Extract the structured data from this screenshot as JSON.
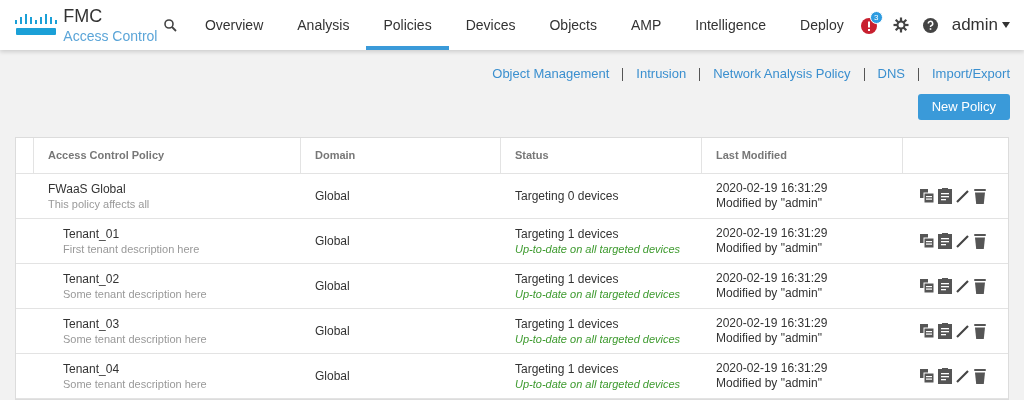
{
  "header": {
    "product": "FMC",
    "subtitle": "Access Control",
    "nav": [
      {
        "label": "Overview",
        "selected": false
      },
      {
        "label": "Analysis",
        "selected": false
      },
      {
        "label": "Policies",
        "selected": true
      },
      {
        "label": "Devices",
        "selected": false
      },
      {
        "label": "Objects",
        "selected": false
      },
      {
        "label": "AMP",
        "selected": false
      },
      {
        "label": "Intelligence",
        "selected": false
      },
      {
        "label": "Deploy",
        "selected": false
      }
    ],
    "alert_count": "3",
    "user": "admin"
  },
  "sub_links": [
    "Object Management",
    "Intrusion",
    "Network Analysis Policy",
    "DNS",
    "Import/Export"
  ],
  "new_policy_button": "New Policy",
  "table": {
    "columns": [
      "Access Control Policy",
      "Domain",
      "Status",
      "Last Modified"
    ],
    "rows": [
      {
        "name": "FWaaS Global",
        "description": "This policy affects all",
        "domain": "Global",
        "status": "Targeting 0 devices",
        "modified": "2020-02-19 16:31:29",
        "modified_by": "Modified by \"admin\"",
        "children": [
          {
            "name": "Tenant_01",
            "description": "First tenant description here",
            "domain": "Global",
            "status": "Targeting 1 devices",
            "status_detail": "Up-to-date on all targeted devices",
            "modified": "2020-02-19 16:31:29",
            "modified_by": "Modified by \"admin\""
          },
          {
            "name": "Tenant_02",
            "description": "Some tenant description here",
            "domain": "Global",
            "status": "Targeting 1 devices",
            "status_detail": "Up-to-date on all targeted devices",
            "modified": "2020-02-19 16:31:29",
            "modified_by": "Modified by \"admin\""
          },
          {
            "name": "Tenant_03",
            "description": "Some tenant description here",
            "domain": "Global",
            "status": "Targeting 1 devices",
            "status_detail": "Up-to-date on all targeted devices",
            "modified": "2020-02-19 16:31:29",
            "modified_by": "Modified by \"admin\""
          },
          {
            "name": "Tenant_04",
            "description": "Some tenant description here",
            "domain": "Global",
            "status": "Targeting 1 devices",
            "status_detail": "Up-to-date on all targeted devices",
            "modified": "2020-02-19 16:31:29",
            "modified_by": "Modified by \"admin\""
          }
        ]
      }
    ]
  }
}
